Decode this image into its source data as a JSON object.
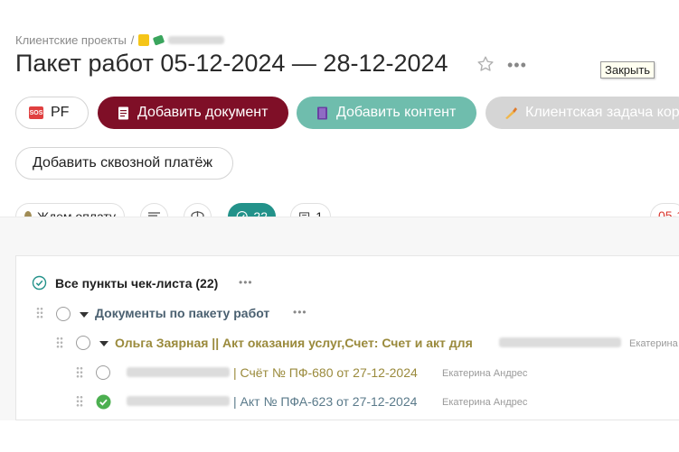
{
  "breadcrumb": {
    "parent": "Клиентские проекты",
    "separator": "/"
  },
  "page_title": "Пакет работ 05-12-2024 — 28-12-2024",
  "tooltip": "Закрыть",
  "actions": {
    "pf_label": "PF",
    "pf_icon_text": "SOS",
    "add_document": "Добавить документ",
    "add_content": "Добавить контент",
    "client_task": "Клиентская задача кор",
    "add_payment": "Добавить сквозной платёж"
  },
  "status": {
    "label": "Ждем оплату",
    "color": "#a08c55"
  },
  "counters": {
    "checklist": "22",
    "comments": "1"
  },
  "due_date_partial": "05-1",
  "checklist": {
    "title": "Все пункты чек-листа (22)",
    "group": "Документы по пакету работ",
    "subgroup": "Ольга Заярная || Акт оказания услуг,Счет: Счет и акт для",
    "subgroup_assignee": "Екатерина",
    "items": [
      {
        "text": "| Счёт № ПФ-680 от 27-12-2024",
        "assignee": "Екатерина Андрес",
        "done": false
      },
      {
        "text": "| Акт № ПФА-623 от 27-12-2024",
        "assignee": "Екатерина Андрес",
        "done": true
      }
    ]
  },
  "colors": {
    "accent_dark": "#7f0f27",
    "accent_teal": "#6fbdad",
    "counter_teal": "#23928a",
    "link_olive": "#9a8a3c",
    "link_slate": "#5a7a8a",
    "done_green": "#4caf50"
  }
}
